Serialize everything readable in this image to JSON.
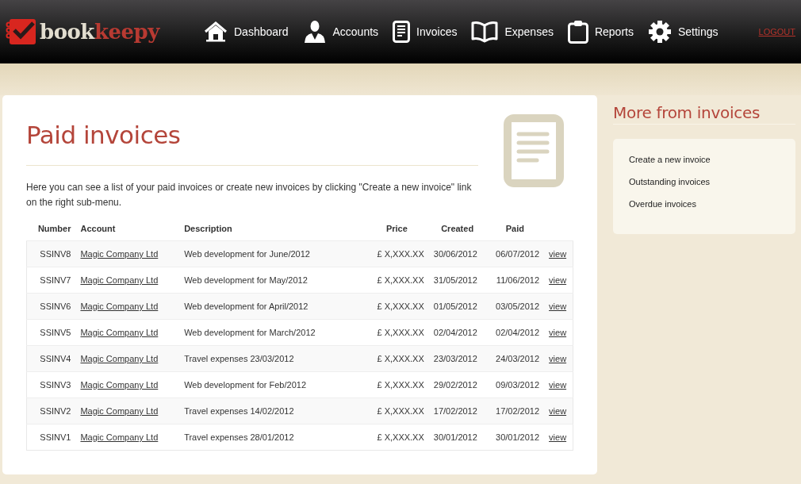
{
  "logo": {
    "part_1": "book",
    "part_2": "keepy"
  },
  "nav": [
    {
      "label": "Dashboard"
    },
    {
      "label": "Accounts"
    },
    {
      "label": "Invoices"
    },
    {
      "label": "Expenses"
    },
    {
      "label": "Reports"
    },
    {
      "label": "Settings"
    }
  ],
  "logout": "LOGOUT",
  "page": {
    "title": "Paid invoices",
    "intro": "Here you can see a list of your paid invoices or create new invoices by clicking \"Create a new invoice\" link on the right sub-menu."
  },
  "table": {
    "columns": [
      "Number",
      "Account",
      "Description",
      "Price",
      "Created",
      "Paid"
    ],
    "rows": [
      {
        "number": "SSINV8",
        "account": "Magic Company Ltd",
        "description": "Web development for June/2012",
        "price": "£ X,XXX.XX",
        "created": "30/06/2012",
        "paid": "06/07/2012",
        "action": "view"
      },
      {
        "number": "SSINV7",
        "account": "Magic Company Ltd",
        "description": "Web development for May/2012",
        "price": "£ X,XXX.XX",
        "created": "31/05/2012",
        "paid": "11/06/2012",
        "action": "view"
      },
      {
        "number": "SSINV6",
        "account": "Magic Company Ltd",
        "description": "Web development for April/2012",
        "price": "£ X,XXX.XX",
        "created": "01/05/2012",
        "paid": "03/05/2012",
        "action": "view"
      },
      {
        "number": "SSINV5",
        "account": "Magic Company Ltd",
        "description": "Web development for March/2012",
        "price": "£ X,XXX.XX",
        "created": "02/04/2012",
        "paid": "02/04/2012",
        "action": "view"
      },
      {
        "number": "SSINV4",
        "account": "Magic Company Ltd",
        "description": "Travel expenses 23/03/2012",
        "price": "£ X,XXX.XX",
        "created": "23/03/2012",
        "paid": "24/03/2012",
        "action": "view"
      },
      {
        "number": "SSINV3",
        "account": "Magic Company Ltd",
        "description": "Web development for Feb/2012",
        "price": "£ X,XXX.XX",
        "created": "29/02/2012",
        "paid": "09/03/2012",
        "action": "view"
      },
      {
        "number": "SSINV2",
        "account": "Magic Company Ltd",
        "description": "Travel expenses 14/02/2012",
        "price": "£ X,XXX.XX",
        "created": "17/02/2012",
        "paid": "17/02/2012",
        "action": "view"
      },
      {
        "number": "SSINV1",
        "account": "Magic Company Ltd",
        "description": "Travel expenses 28/01/2012",
        "price": "£ X,XXX.XX",
        "created": "30/01/2012",
        "paid": "30/01/2012",
        "action": "view"
      }
    ]
  },
  "sidebar": {
    "title": "More from invoices",
    "items": [
      "Create a new invoice",
      "Outstanding invoices",
      "Overdue invoices"
    ]
  }
}
